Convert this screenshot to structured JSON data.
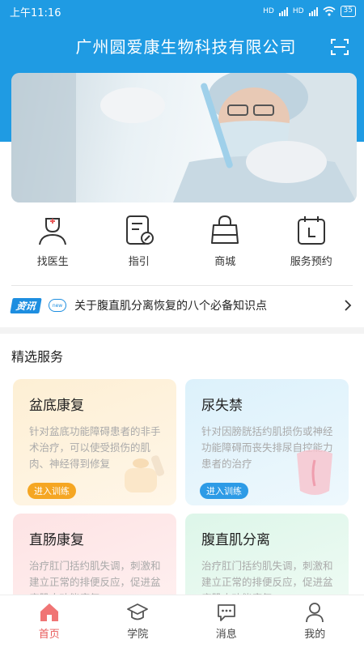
{
  "status_bar": {
    "time": "上午11:16",
    "battery": "35",
    "net1": "HD",
    "net2": "HD"
  },
  "header": {
    "title": "广州圆爱康生物科技有限公司"
  },
  "quick_nav": [
    {
      "label": "找医生",
      "icon": "doctor-icon"
    },
    {
      "label": "指引",
      "icon": "guide-icon"
    },
    {
      "label": "商城",
      "icon": "shopping-bag-icon"
    },
    {
      "label": "服务预约",
      "icon": "calendar-clock-icon"
    }
  ],
  "news": {
    "tag": "资讯",
    "badge": "new",
    "text": "关于腹直肌分离恢复的八个必备知识点"
  },
  "section": {
    "title": "精选服务"
  },
  "cards": [
    {
      "title": "盆底康复",
      "desc": "针对盆底功能障碍患者的非手术治疗，可以使受损伤的肌肉、神经得到修复",
      "button": "进入训练",
      "accent": "#f5a623"
    },
    {
      "title": "尿失禁",
      "desc": "针对因膀胱括约肌损伤或神经功能障碍而丧失排尿自控能力患者的治疗",
      "button": "进入训练",
      "accent": "#2d9be6"
    },
    {
      "title": "直肠康复",
      "desc": "治疗肛门括约肌失调，刺激和建立正常的排便反应，促进盆底肌肉功能康复"
    },
    {
      "title": "腹直肌分离",
      "desc": "治疗肛门括约肌失调，刺激和建立正常的排便反应，促进盆底肌肉功能康复"
    }
  ],
  "tabbar": [
    {
      "label": "首页",
      "icon": "home-icon",
      "active": true
    },
    {
      "label": "学院",
      "icon": "graduation-cap-icon",
      "active": false
    },
    {
      "label": "消息",
      "icon": "chat-bubble-icon",
      "active": false
    },
    {
      "label": "我的",
      "icon": "user-icon",
      "active": false
    }
  ],
  "colors": {
    "primary": "#1f9be3",
    "active_tab": "#e85a5a"
  }
}
